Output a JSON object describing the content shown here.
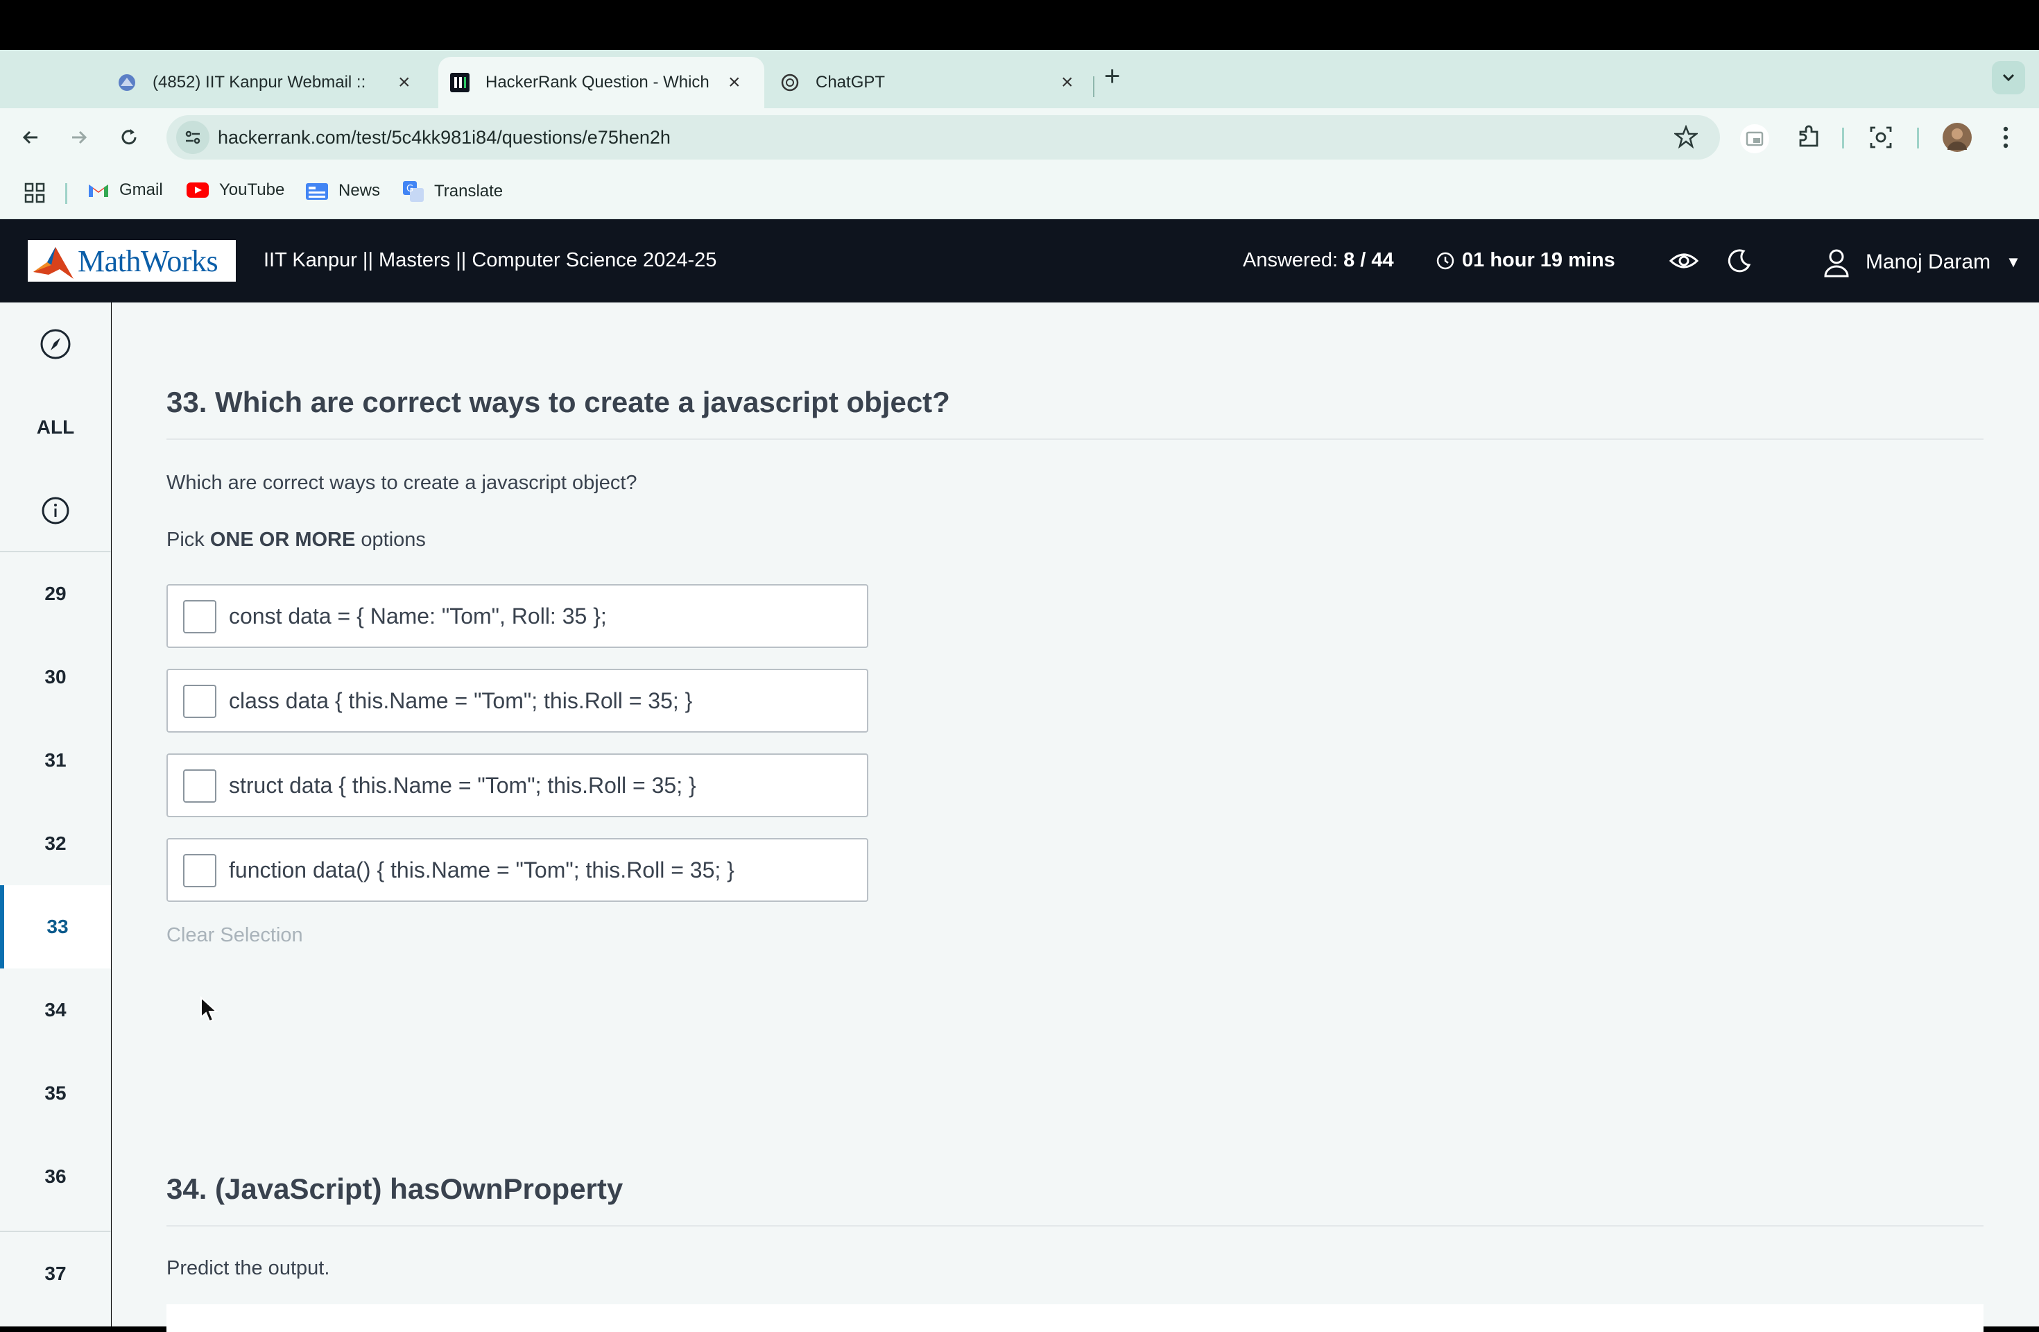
{
  "browser": {
    "tabs": [
      {
        "title": "(4852) IIT Kanpur Webmail ::",
        "icon": "webmail-icon"
      },
      {
        "title": "HackerRank Question - Which",
        "icon": "hackerrank-icon"
      },
      {
        "title": "ChatGPT",
        "icon": "chatgpt-icon"
      }
    ],
    "url": "hackerrank.com/test/5c4kk981i84/questions/e75hen2h",
    "bookmarks": [
      "Gmail",
      "YouTube",
      "News",
      "Translate"
    ]
  },
  "header": {
    "logo_text": "MathWorks",
    "test_title": "IIT Kanpur || Masters || Computer Science 2024-25",
    "answered_label": "Answered:",
    "answered_value": "8 / 44",
    "timer": "01 hour 19 mins",
    "user_name": "Manoj Daram"
  },
  "sidebar": {
    "all_label": "ALL",
    "items": [
      "29",
      "30",
      "31",
      "32",
      "33",
      "34",
      "35",
      "36",
      "37"
    ],
    "active": "33"
  },
  "question33": {
    "title": "33. Which are correct ways to create a javascript object?",
    "prompt": "Which are correct ways to create a javascript object?",
    "pick_prefix": "Pick",
    "pick_bold": "ONE OR MORE",
    "pick_suffix": "options",
    "options": [
      "const data = { Name: \"Tom\", Roll: 35 };",
      "class data { this.Name = \"Tom\"; this.Roll = 35; }",
      "struct data { this.Name = \"Tom\"; this.Roll = 35; }",
      "function data() { this.Name = \"Tom\"; this.Roll = 35; }"
    ],
    "clear_label": "Clear Selection"
  },
  "question34": {
    "title": "34. (JavaScript) hasOwnProperty",
    "prompt": "Predict the output."
  },
  "colors": {
    "header_bg": "#0e141e",
    "tab_strip": "#d6ebe6",
    "active_sidebar": "#0a6fb0"
  }
}
